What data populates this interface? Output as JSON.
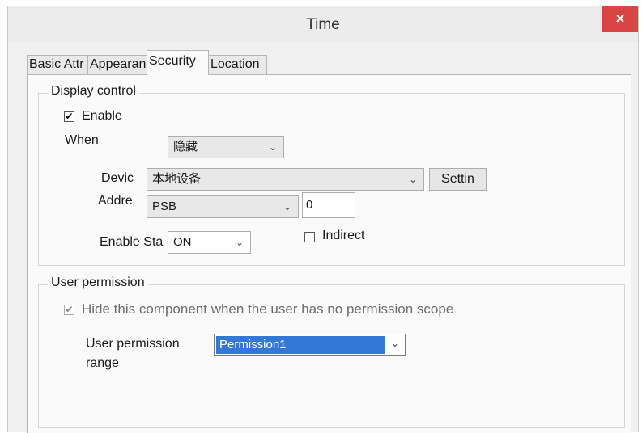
{
  "window": {
    "title": "Time",
    "close_label": "×"
  },
  "tabs": [
    "Basic Attr",
    "Appearance",
    "Security",
    "Location"
  ],
  "display_control": {
    "group_label": "Display control",
    "enable_label": "Enable",
    "enable_checked": true,
    "when_label": "When",
    "when_value": "隐藏",
    "device_label": "Devic",
    "device_value": "本地设备",
    "settings_label": "Settin",
    "address_label": "Addre",
    "address_type": "PSB",
    "address_value": "0",
    "enable_state_label": "Enable Sta",
    "enable_state_value": "ON",
    "indirect_label": "Indirect",
    "indirect_checked": false
  },
  "user_permission": {
    "group_label": "User permission",
    "hide_label": "Hide this component when the user has no permission scope",
    "hide_checked": true,
    "range_label_line1": "User permission",
    "range_label_line2": "range",
    "range_value": "Permission1"
  },
  "icons": {
    "check": "✔",
    "dropdown": "⌄"
  }
}
